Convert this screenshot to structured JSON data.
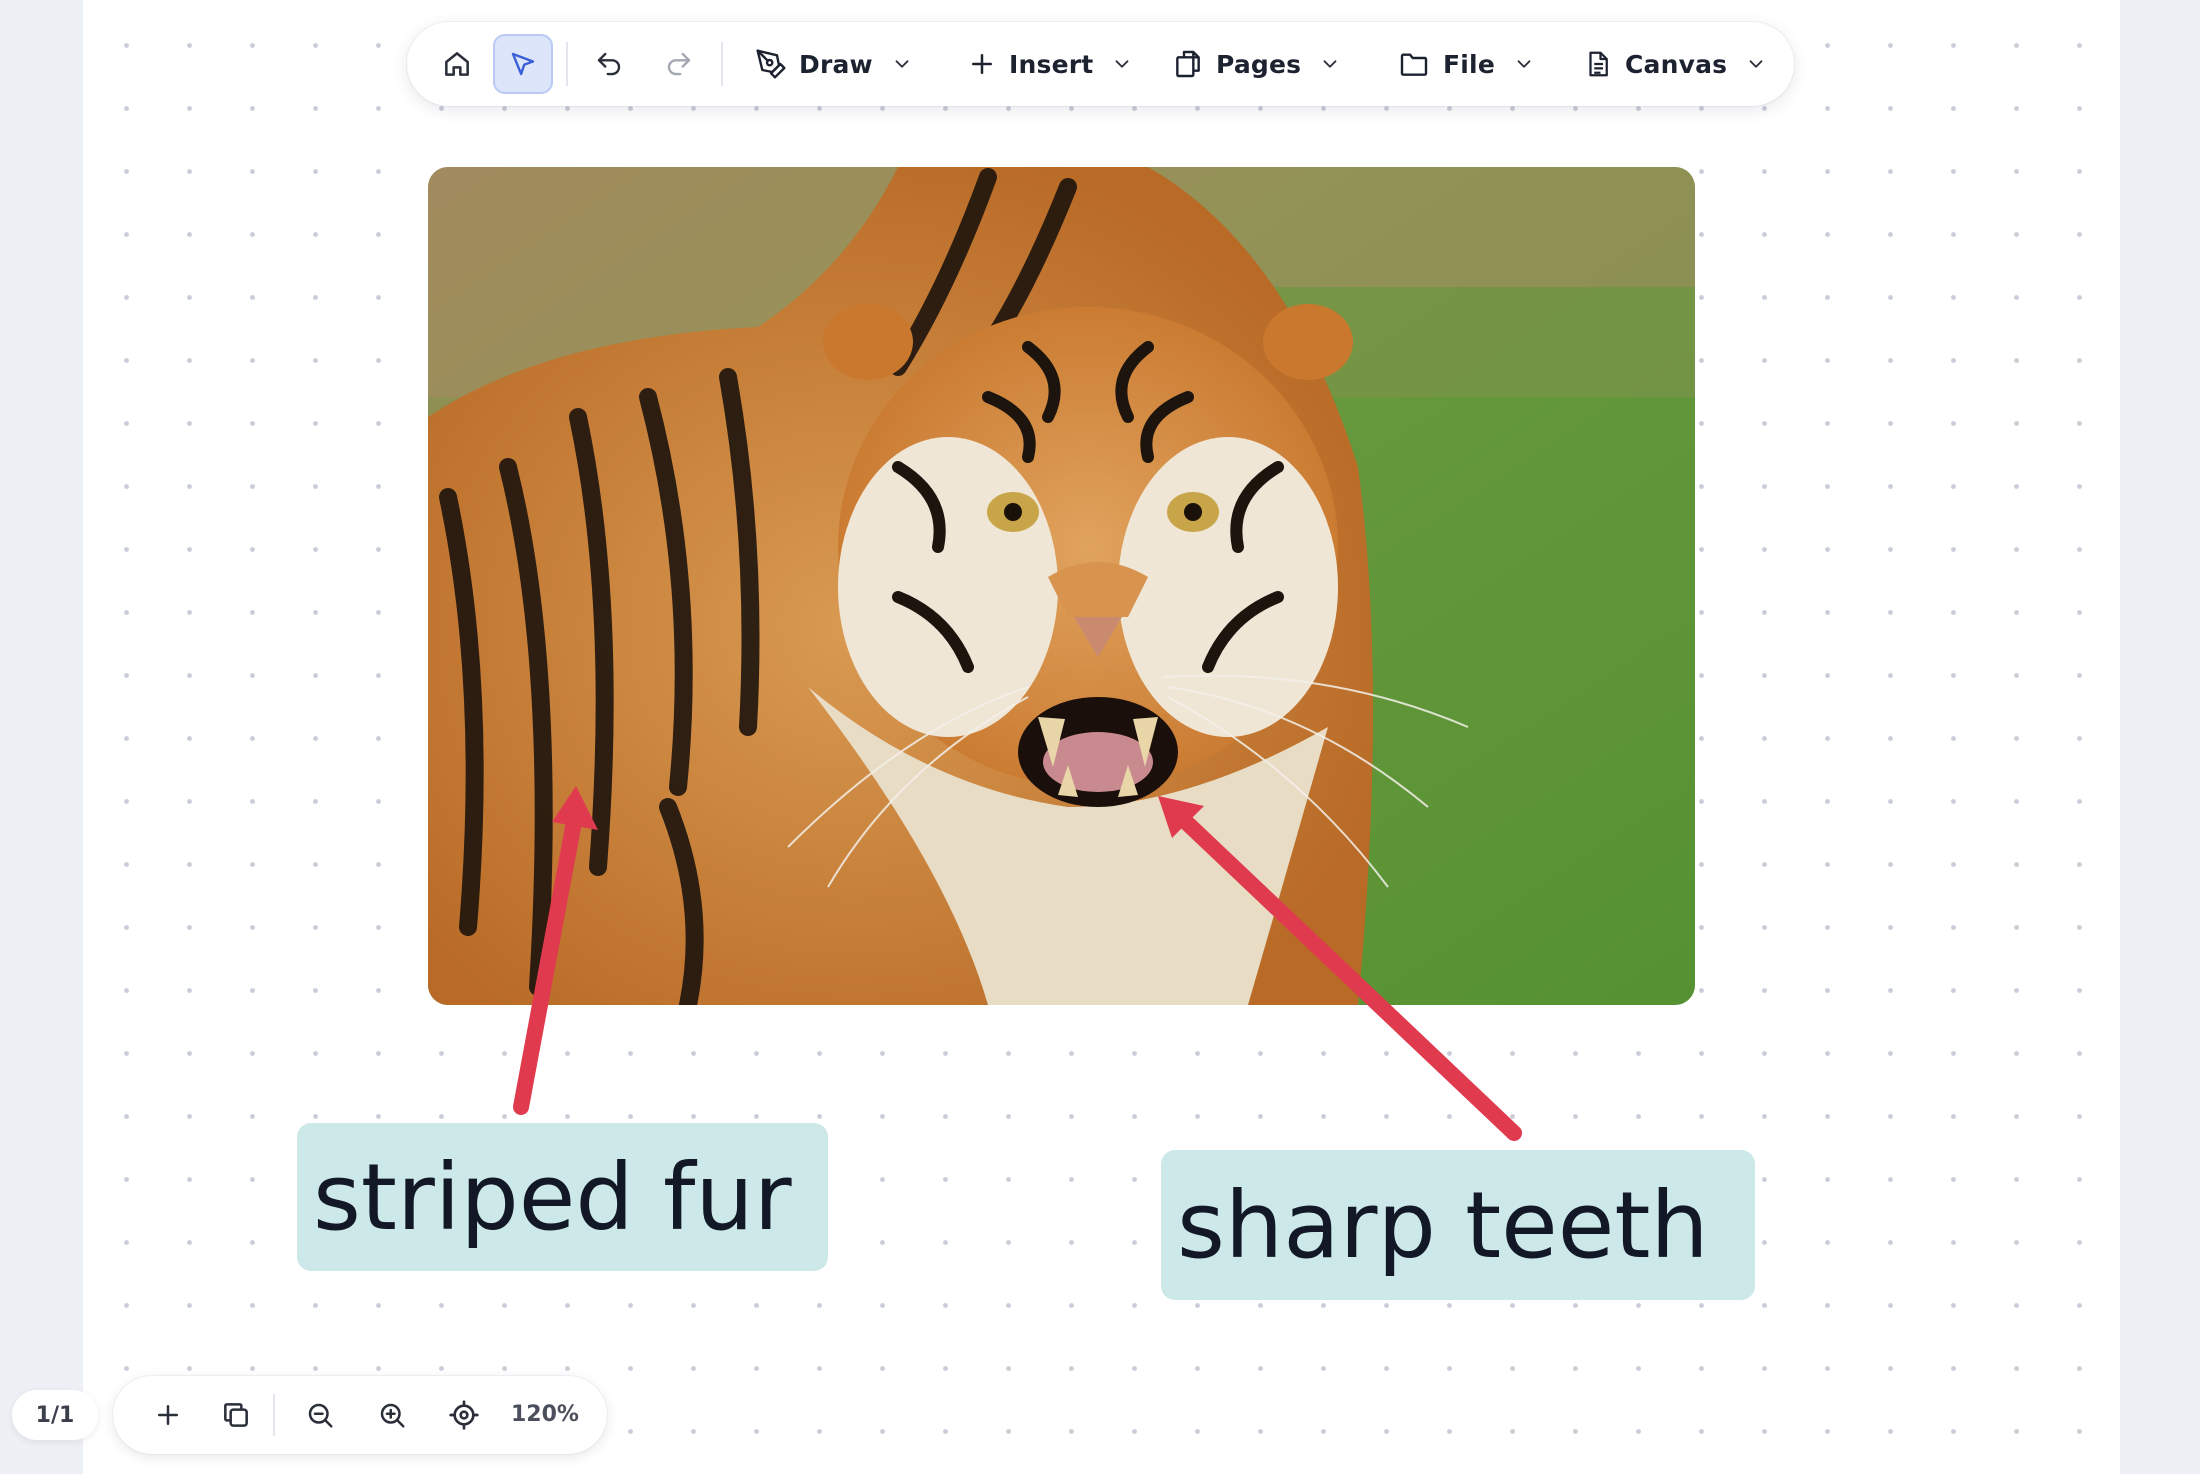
{
  "toolbar": {
    "home_icon": "home-icon",
    "select_icon": "cursor-pointer-icon",
    "undo_icon": "undo-icon",
    "redo_icon": "redo-icon",
    "menus": [
      {
        "label": "Draw",
        "icon": "pen-tool-icon"
      },
      {
        "label": "Insert",
        "icon": "plus-icon"
      },
      {
        "label": "Pages",
        "icon": "copy-pages-icon"
      },
      {
        "label": "File",
        "icon": "folder-icon"
      },
      {
        "label": "Canvas",
        "icon": "document-icon"
      }
    ]
  },
  "canvas": {
    "image_subject": "tiger photo",
    "annotations": [
      {
        "text": "striped fur",
        "color": "#cce8e8"
      },
      {
        "text": "sharp teeth",
        "color": "#cce8e8"
      }
    ],
    "arrow_color": "#e03a4f"
  },
  "footer": {
    "page_indicator": "1/1",
    "zoom": "120%"
  },
  "colors": {
    "accent": "#3b5fd6",
    "background": "#edf0f5",
    "label_fill": "#cce8e8",
    "arrow": "#e03a4f"
  }
}
